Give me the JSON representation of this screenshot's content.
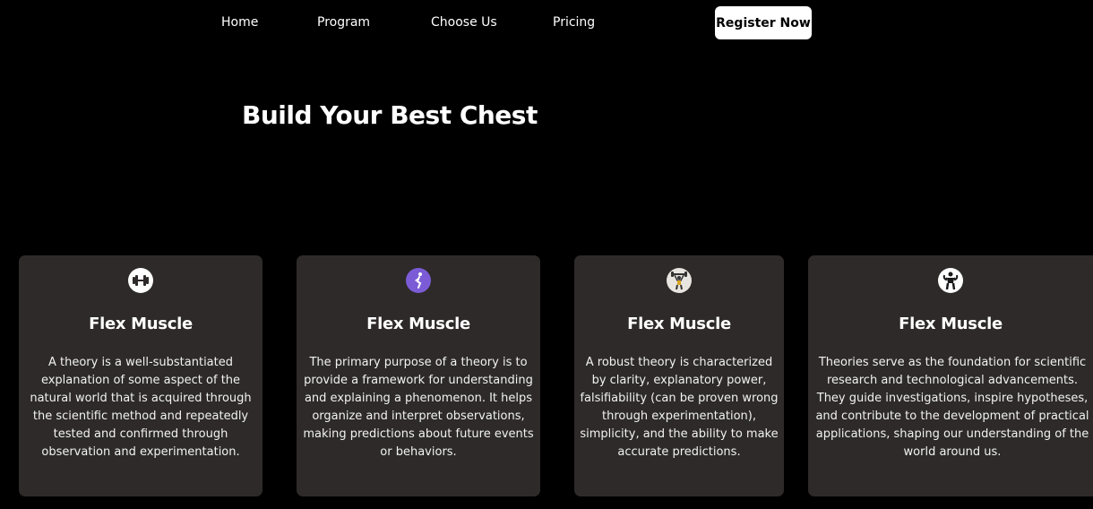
{
  "nav": {
    "links": [
      {
        "label": "Home"
      },
      {
        "label": "Program"
      },
      {
        "label": "Choose Us"
      },
      {
        "label": "Pricing"
      }
    ],
    "cta_label": "Register Now"
  },
  "hero": {
    "title": "Build Your Best Chest"
  },
  "cards": [
    {
      "icon": "dumbbell-icon",
      "title": "Flex Muscle",
      "text": "A theory is a well-substantiated explanation of some aspect of the natural world that is acquired through the scientific method and repeatedly tested and confirmed through observation and experimentation."
    },
    {
      "icon": "running-figure-icon",
      "title": "Flex Muscle",
      "text": "The primary purpose of a theory is to provide a framework for understanding and explaining a phenomenon. It helps organize and interpret observations, making predictions about future events or behaviors."
    },
    {
      "icon": "weightlifter-icon",
      "title": "Flex Muscle",
      "text": "A robust theory is characterized by clarity, explanatory power, falsifiability (can be proven wrong through experimentation), simplicity, and the ability to make accurate predictions."
    },
    {
      "icon": "bodybuilder-icon",
      "title": "Flex Muscle",
      "text": "Theories serve as the foundation for scientific research and technological advancements. They guide investigations, inspire hypotheses, and contribute to the development of practical applications, shaping our understanding of the world around us."
    }
  ],
  "colors": {
    "background": "#000000",
    "card": "#2d2a29",
    "button": "#ffffff",
    "icon_purple": "#7b5cd6"
  }
}
